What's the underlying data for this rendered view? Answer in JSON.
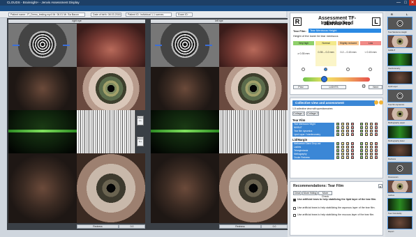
{
  "window": {
    "title": "CLOUDS - Brainsight+ - Jenvis Assessment Display",
    "min": "—",
    "max": "□",
    "close": "✕"
  },
  "menu": [
    "Patient",
    "Examination",
    "Display",
    "Settings",
    "Help",
    "Print",
    "IPH",
    "External Software"
  ],
  "toolbar": {
    "patient": "Patient name: JT_Demo_testing.mp4 Mr. 06.01 Mr. Ba Bacon",
    "date_label": "Date of birth: 08.03.2016",
    "patient_id": "Patient ID: Individual 1.1 scenes",
    "exam": "Exam ID: ..."
  },
  "panes": {
    "right_eye": "right eye",
    "left_eye": "left eye"
  },
  "left_pane": {
    "side_buttons": [
      "Zoom L.L",
      "Zoom S.L"
    ],
    "right_bottom": {
      "label": "Redness",
      "value": "0.0"
    },
    "left_bottom": {
      "label": "Redness",
      "value": "0.0"
    }
  },
  "assessment": {
    "r_letter": "R",
    "l_letter": "L",
    "title_line1": "Assessment TF-Individualized",
    "title_line2": "JENVIS Pro",
    "field_label": "Tear Film:",
    "field_value": "Tear Meniscus Height",
    "description": "Height of the lower lid tear meniscus",
    "grades": [
      {
        "name": "Very high",
        "color": "#8fd06b",
        "value": "≥ 0.35 mm"
      },
      {
        "name": "Normal",
        "color": "#f3e98a",
        "value": "0.35 – 0.2 mm"
      },
      {
        "name": "Slightly reduced",
        "color": "#f7c58e",
        "value": "0.2 – 0.15 mm"
      },
      {
        "name": "Low",
        "color": "#f08a86",
        "value": "< 0.15 mm"
      }
    ],
    "slider": {
      "left": "Prev",
      "mid": "LIGHTS",
      "right": "Next"
    }
  },
  "collective": {
    "title": "Collective view and assessment",
    "subtitle": "1-5 collective view with questionnaires",
    "tabs": [
      "Collage 1",
      "Collage 2"
    ],
    "tear_film_header": "Tear Film",
    "tear_film_rows": [
      "Tear Meniscus Height",
      "NIKBUT",
      "Tear film dynamics",
      "Lipid Layer / Interferometry"
    ],
    "lid_header": "Lid/Margin",
    "lid_rows": [
      "Meibomian Gland Drop-out",
      "Lashes",
      "Telangiectasia",
      "Meibography",
      "Ocular Redness"
    ]
  },
  "recommendations": {
    "title": "Recommendations: Tear Film",
    "tabs": [
      "Clear",
      "More Hdlng",
      "More Check"
    ],
    "items": [
      "Use artificial tears to help stabilizing the lipid layer of the tear film.",
      "Use artificial tears to help stabilizing the aqueous layer of the tear film.",
      "Use artificial tears to help stabilizing the mucous layer of the tear film."
    ]
  },
  "thumbs": {
    "header_r": "R",
    "header_l": "L",
    "labels": [
      "Tear Meniscus Height",
      "NIKBUT",
      "Interferometry",
      "Lipid Layer",
      "Tear film dynamics",
      "Meibography upper",
      "Meibography lower",
      "Redness",
      "Fluorescein",
      "Lashes",
      "Tear Osmolarity",
      "Report"
    ]
  }
}
